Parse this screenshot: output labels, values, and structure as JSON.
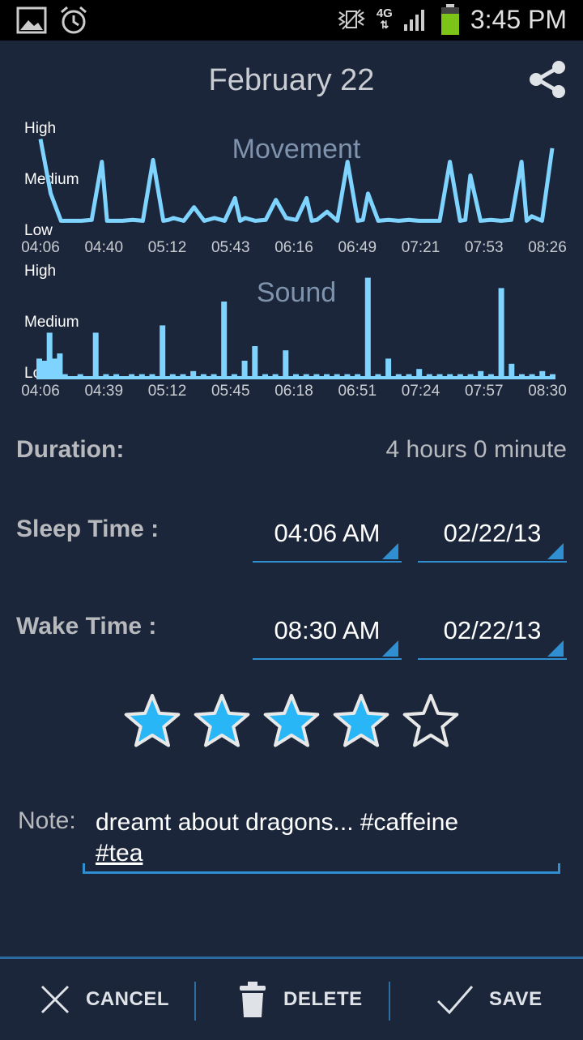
{
  "status_bar": {
    "time": "3:45 PM",
    "network": "4G"
  },
  "header": {
    "title": "February 22"
  },
  "charts": {
    "movement": {
      "title": "Movement",
      "y_labels": [
        "High",
        "Medium",
        "Low"
      ],
      "x_ticks": [
        "04:06",
        "04:40",
        "05:12",
        "05:43",
        "06:16",
        "06:49",
        "07:21",
        "07:53",
        "08:26"
      ]
    },
    "sound": {
      "title": "Sound",
      "y_labels": [
        "High",
        "Medium",
        "Low"
      ],
      "x_ticks": [
        "04:06",
        "04:39",
        "05:12",
        "05:45",
        "06:18",
        "06:51",
        "07:24",
        "07:57",
        "08:30"
      ]
    }
  },
  "chart_data": [
    {
      "type": "line",
      "title": "Movement",
      "y_categories": [
        "Low",
        "Medium",
        "High"
      ],
      "ylim": [
        0,
        1
      ],
      "x_tick_labels": [
        "04:06",
        "04:40",
        "05:12",
        "05:43",
        "06:16",
        "06:49",
        "07:21",
        "07:53",
        "08:26"
      ],
      "x": [
        0,
        0.02,
        0.04,
        0.06,
        0.08,
        0.1,
        0.12,
        0.13,
        0.14,
        0.16,
        0.18,
        0.2,
        0.22,
        0.24,
        0.25,
        0.26,
        0.28,
        0.3,
        0.32,
        0.34,
        0.36,
        0.38,
        0.39,
        0.4,
        0.42,
        0.44,
        0.46,
        0.48,
        0.5,
        0.52,
        0.53,
        0.54,
        0.56,
        0.58,
        0.6,
        0.62,
        0.63,
        0.64,
        0.66,
        0.68,
        0.7,
        0.72,
        0.74,
        0.76,
        0.78,
        0.8,
        0.82,
        0.83,
        0.84,
        0.86,
        0.88,
        0.9,
        0.92,
        0.94,
        0.95,
        0.96,
        0.98,
        1.0
      ],
      "series": [
        {
          "values": [
            0.95,
            0.35,
            0.05,
            0.05,
            0.05,
            0.06,
            0.7,
            0.05,
            0.05,
            0.05,
            0.06,
            0.05,
            0.72,
            0.05,
            0.06,
            0.08,
            0.05,
            0.2,
            0.05,
            0.08,
            0.05,
            0.3,
            0.05,
            0.08,
            0.05,
            0.06,
            0.28,
            0.08,
            0.06,
            0.3,
            0.05,
            0.06,
            0.15,
            0.05,
            0.7,
            0.05,
            0.06,
            0.35,
            0.05,
            0.06,
            0.05,
            0.06,
            0.05,
            0.05,
            0.05,
            0.7,
            0.05,
            0.06,
            0.55,
            0.05,
            0.06,
            0.05,
            0.06,
            0.7,
            0.05,
            0.1,
            0.05,
            0.85
          ]
        }
      ]
    },
    {
      "type": "bar",
      "title": "Sound",
      "y_categories": [
        "Low",
        "Medium",
        "High"
      ],
      "ylim": [
        0,
        1
      ],
      "x_tick_labels": [
        "04:06",
        "04:39",
        "05:12",
        "05:45",
        "06:18",
        "06:51",
        "07:24",
        "07:57",
        "08:30"
      ],
      "x": [
        0.0,
        0.01,
        0.02,
        0.03,
        0.04,
        0.05,
        0.08,
        0.11,
        0.13,
        0.15,
        0.18,
        0.2,
        0.22,
        0.24,
        0.26,
        0.28,
        0.3,
        0.32,
        0.34,
        0.36,
        0.38,
        0.4,
        0.42,
        0.44,
        0.46,
        0.48,
        0.5,
        0.52,
        0.54,
        0.56,
        0.58,
        0.6,
        0.62,
        0.64,
        0.66,
        0.68,
        0.7,
        0.72,
        0.74,
        0.76,
        0.78,
        0.8,
        0.82,
        0.84,
        0.86,
        0.88,
        0.9,
        0.92,
        0.94,
        0.96,
        0.98,
        1.0
      ],
      "series": [
        {
          "values": [
            0.2,
            0.18,
            0.45,
            0.2,
            0.25,
            0.05,
            0.05,
            0.45,
            0.05,
            0.05,
            0.05,
            0.05,
            0.05,
            0.52,
            0.05,
            0.05,
            0.08,
            0.05,
            0.05,
            0.75,
            0.05,
            0.18,
            0.32,
            0.05,
            0.05,
            0.28,
            0.05,
            0.05,
            0.05,
            0.05,
            0.05,
            0.05,
            0.05,
            0.98,
            0.05,
            0.2,
            0.05,
            0.05,
            0.1,
            0.05,
            0.05,
            0.05,
            0.05,
            0.05,
            0.08,
            0.05,
            0.88,
            0.15,
            0.05,
            0.05,
            0.08,
            0.05
          ]
        }
      ]
    }
  ],
  "details": {
    "duration_label": "Duration:",
    "duration_value": "4 hours 0 minute",
    "sleep_label": "Sleep Time :",
    "sleep_time": "04:06 AM",
    "sleep_date": "02/22/13",
    "wake_label": "Wake Time :",
    "wake_time": "08:30 AM",
    "wake_date": "02/22/13"
  },
  "rating": {
    "value": 4,
    "max": 5,
    "filled_color": "#29b6f6"
  },
  "note": {
    "label": "Note:",
    "text": "dreamt about dragons... #caffeine",
    "tag": "#tea"
  },
  "actions": {
    "cancel": "CANCEL",
    "delete": "DELETE",
    "save": "SAVE"
  }
}
